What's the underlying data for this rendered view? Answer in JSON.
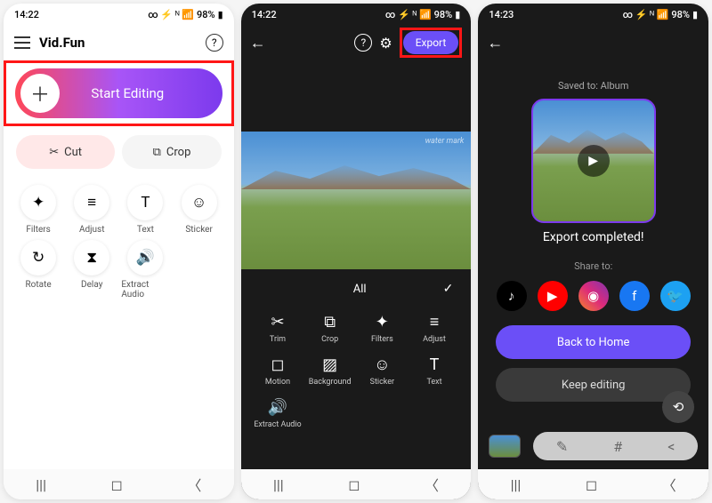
{
  "status": {
    "time1": "14:22",
    "time2": "14:22",
    "time3": "14:23",
    "battery": "98%"
  },
  "screen1": {
    "app_title": "Vid.Fun",
    "start_label": "Start Editing",
    "cut_label": "Cut",
    "crop_label": "Crop",
    "tools": [
      {
        "icon": "✦",
        "label": "Filters"
      },
      {
        "icon": "≡",
        "label": "Adjust"
      },
      {
        "icon": "T",
        "label": "Text"
      },
      {
        "icon": "☺",
        "label": "Sticker"
      },
      {
        "icon": "↻",
        "label": "Rotate"
      },
      {
        "icon": "⧗",
        "label": "Delay"
      },
      {
        "icon": "🔊",
        "label": "Extract Audio"
      }
    ]
  },
  "screen2": {
    "export_label": "Export",
    "watermark": "water mark",
    "tab_label": "All",
    "tools": [
      {
        "icon": "✂",
        "label": "Trim"
      },
      {
        "icon": "⧉",
        "label": "Crop"
      },
      {
        "icon": "✦",
        "label": "Filters"
      },
      {
        "icon": "≡",
        "label": "Adjust"
      },
      {
        "icon": "◻",
        "label": "Motion"
      },
      {
        "icon": "▨",
        "label": "Background"
      },
      {
        "icon": "☺",
        "label": "Sticker"
      },
      {
        "icon": "T",
        "label": "Text"
      },
      {
        "icon": "🔊",
        "label": "Extract Audio"
      }
    ]
  },
  "screen3": {
    "saved_to": "Saved to: Album",
    "done": "Export completed!",
    "share_to": "Share to:",
    "back_home": "Back to Home",
    "keep_editing": "Keep editing"
  }
}
